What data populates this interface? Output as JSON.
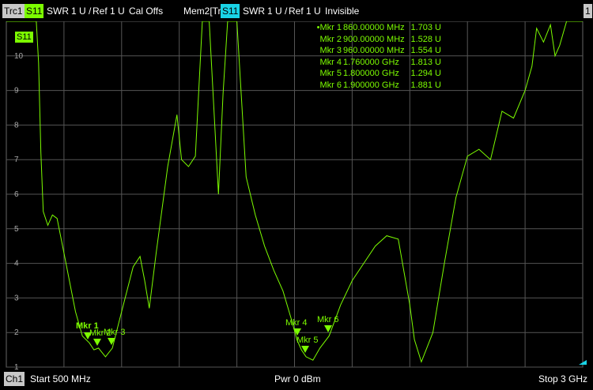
{
  "header": {
    "trace_tab": "Trc1",
    "param": "S11",
    "format": "SWR",
    "scale": "1 U /",
    "ref": "Ref 1 U",
    "cal": "Cal Offs",
    "mem_trace": "Mem2[Trc1]",
    "mem_param": "S11",
    "mem_format": "SWR",
    "mem_scale": "1 U /",
    "mem_ref": "Ref 1 U",
    "mem_state": "Invisible",
    "window_num": "1"
  },
  "trace_label": "S11",
  "markers": [
    {
      "bullet": "•",
      "name": "Mkr 1",
      "freq": "860.00000 MHz",
      "value": "1.703 U"
    },
    {
      "bullet": "",
      "name": "Mkr 2",
      "freq": "900.00000 MHz",
      "value": "1.528 U"
    },
    {
      "bullet": "",
      "name": "Mkr 3",
      "freq": "960.00000 MHz",
      "value": "1.554 U"
    },
    {
      "bullet": "",
      "name": "Mkr 4",
      "freq": "1.760000 GHz",
      "value": "1.813 U"
    },
    {
      "bullet": "",
      "name": "Mkr 5",
      "freq": "1.800000 GHz",
      "value": "1.294 U"
    },
    {
      "bullet": "",
      "name": "Mkr 6",
      "freq": "1.900000 GHz",
      "value": "1.881 U"
    }
  ],
  "marker_labels": [
    "Mkr 1",
    "Mkr 2",
    "Mkr 3",
    "Mkr 4",
    "Mkr 5",
    "Mkr 6"
  ],
  "footer": {
    "channel": "Ch1",
    "start": "Start 500 MHz",
    "power": "Pwr 0 dBm",
    "stop": "Stop 3 GHz"
  },
  "colors": {
    "trace": "#7CFC00",
    "grid": "#555555",
    "mem_param": "#19d3e6"
  },
  "chart_data": {
    "type": "line",
    "xlabel": "",
    "ylabel": "",
    "x_range_mhz": [
      500,
      3000
    ],
    "ylim": [
      1,
      11
    ],
    "y_ticks": [
      "10",
      "9",
      "8",
      "7",
      "6",
      "5",
      "4",
      "3",
      "2",
      "1"
    ],
    "grid": true,
    "series": [
      {
        "x": [
          500,
          630,
          640,
          650,
          660,
          680,
          700,
          720,
          750,
          800,
          830,
          860,
          880,
          900,
          930,
          960,
          1000,
          1050,
          1080,
          1100,
          1120,
          1150,
          1200,
          1240,
          1260,
          1290,
          1320,
          1350,
          1380,
          1420,
          1440,
          1460,
          1500,
          1540,
          1580,
          1620,
          1660,
          1700,
          1740,
          1760,
          1780,
          1800,
          1830,
          1860,
          1900,
          1950,
          2000,
          2050,
          2100,
          2150,
          2200,
          2250,
          2270,
          2300,
          2350,
          2400,
          2450,
          2500,
          2550,
          2600,
          2650,
          2700,
          2750,
          2780,
          2800,
          2830,
          2860,
          2880,
          2900,
          2930,
          3000
        ],
        "values": [
          11,
          11,
          9.8,
          7.2,
          5.5,
          5.1,
          5.4,
          5.3,
          4.3,
          2.6,
          1.9,
          1.7,
          1.5,
          1.55,
          1.3,
          1.55,
          2.6,
          3.9,
          4.2,
          3.5,
          2.7,
          4.3,
          6.8,
          8.3,
          7.0,
          6.8,
          7.1,
          11,
          11,
          6.0,
          8.9,
          11,
          11,
          6.5,
          5.4,
          4.5,
          3.8,
          3.2,
          2.3,
          1.8,
          1.5,
          1.3,
          1.2,
          1.55,
          1.9,
          2.8,
          3.5,
          4.0,
          4.5,
          4.8,
          4.7,
          2.8,
          1.8,
          1.15,
          2.0,
          4.0,
          5.9,
          7.1,
          7.3,
          7.0,
          8.4,
          8.2,
          9.0,
          9.7,
          10.8,
          10.4,
          10.9,
          10.0,
          10.3,
          11,
          11
        ]
      }
    ]
  }
}
